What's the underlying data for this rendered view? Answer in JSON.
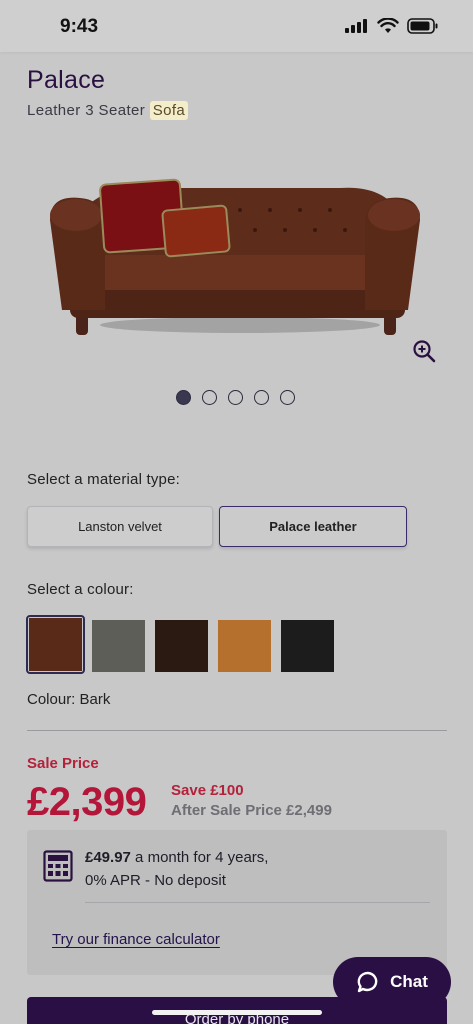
{
  "status": {
    "time": "9:43"
  },
  "product": {
    "title": "Palace",
    "subtitle_prefix": "Leather 3 Seater ",
    "subtitle_highlight": "Sofa"
  },
  "gallery": {
    "slide_count": 5,
    "active_index": 0
  },
  "material": {
    "label": "Select a material type:",
    "options": [
      "Lanston velvet",
      "Palace leather"
    ],
    "selected": "Palace leather"
  },
  "colour": {
    "label": "Select a colour:",
    "swatches": [
      "#5a2a18",
      "#5e5e58",
      "#2a1a12",
      "#b5702e",
      "#1c1c1c"
    ],
    "selected_text": "Colour: Bark"
  },
  "pricing": {
    "sale_label": "Sale Price",
    "price": "£2,399",
    "save": "Save £100",
    "after_sale": "After Sale Price £2,499"
  },
  "finance": {
    "monthly_amount": "£49.97",
    "monthly_rest": " a month for 4 years,",
    "terms": "0% APR - No deposit",
    "calculator_link": "Try our finance calculator"
  },
  "actions": {
    "chat": "Chat",
    "order_by_phone": "Order by phone"
  },
  "colors": {
    "brand": "#2a0f44",
    "sale": "#b4163a"
  }
}
